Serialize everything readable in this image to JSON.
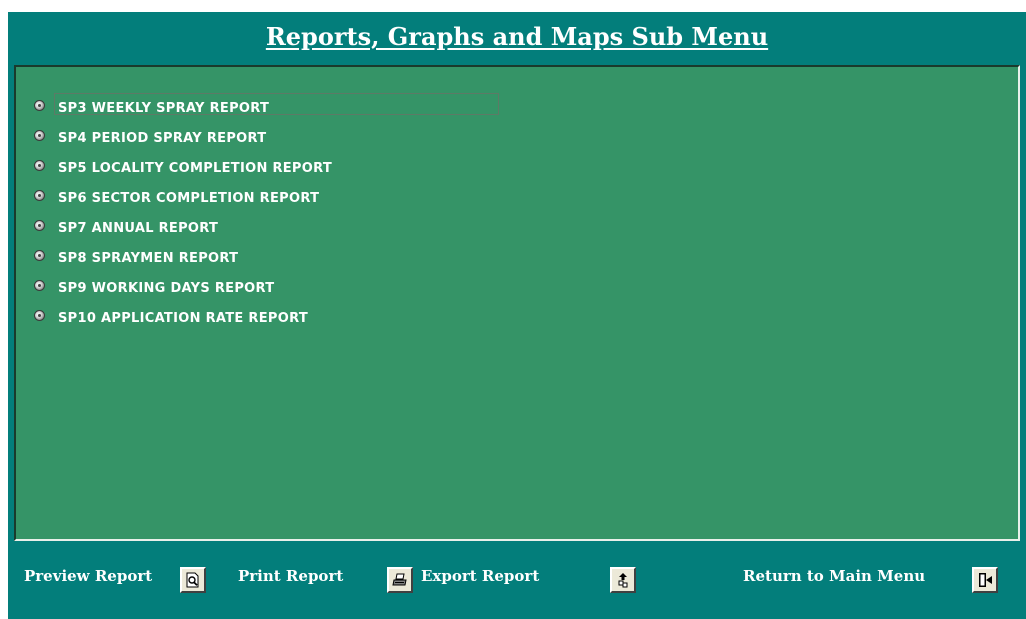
{
  "title": "Reports, Graphs and Maps Sub Menu",
  "reports": [
    {
      "label": "SP3 WEEKLY SPRAY REPORT",
      "selected": true
    },
    {
      "label": "SP4 PERIOD SPRAY REPORT",
      "selected": false
    },
    {
      "label": "SP5 LOCALITY COMPLETION REPORT",
      "selected": false
    },
    {
      "label": "SP6 SECTOR COMPLETION REPORT",
      "selected": false
    },
    {
      "label": "SP7 ANNUAL REPORT",
      "selected": false
    },
    {
      "label": "SP8 SPRAYMEN REPORT",
      "selected": false
    },
    {
      "label": "SP9 WORKING DAYS REPORT",
      "selected": false
    },
    {
      "label": "SP10 APPLICATION RATE REPORT",
      "selected": false
    }
  ],
  "actions": {
    "preview": {
      "label": "Preview Report",
      "icon": "preview-magnifier-icon"
    },
    "print": {
      "label": "Print Report",
      "icon": "printer-icon"
    },
    "export": {
      "label": "Export Report",
      "icon": "export-icon"
    },
    "return": {
      "label": "Return to Main Menu",
      "icon": "exit-door-icon"
    }
  },
  "colors": {
    "frame": "#037e7b",
    "panel": "#359467",
    "text": "#ffffff",
    "button_face": "#ece9d8"
  }
}
